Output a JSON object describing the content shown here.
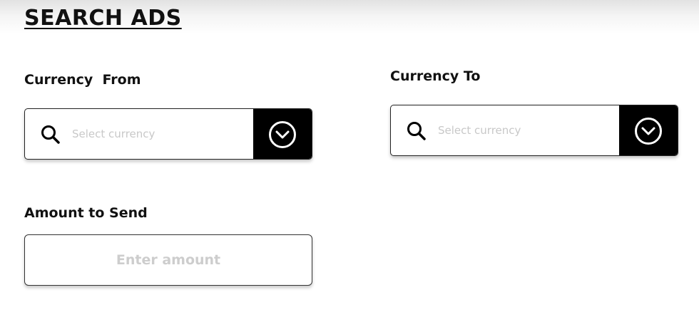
{
  "page": {
    "title": "SEARCH ADS"
  },
  "currency_from": {
    "label": "Currency  From",
    "placeholder": "Select currency",
    "value": "",
    "icon": "search-icon",
    "dropdown_icon": "chevron-down-circle-icon"
  },
  "currency_to": {
    "label": "Currency To",
    "placeholder": "Select currency",
    "value": "",
    "icon": "search-icon",
    "dropdown_icon": "chevron-down-circle-icon"
  },
  "amount": {
    "label": "Amount to Send",
    "placeholder": "Enter amount",
    "value": ""
  },
  "colors": {
    "text": "#111111",
    "button_bg": "#000000",
    "placeholder": "#c8c8c8",
    "background": "#ffffff"
  }
}
